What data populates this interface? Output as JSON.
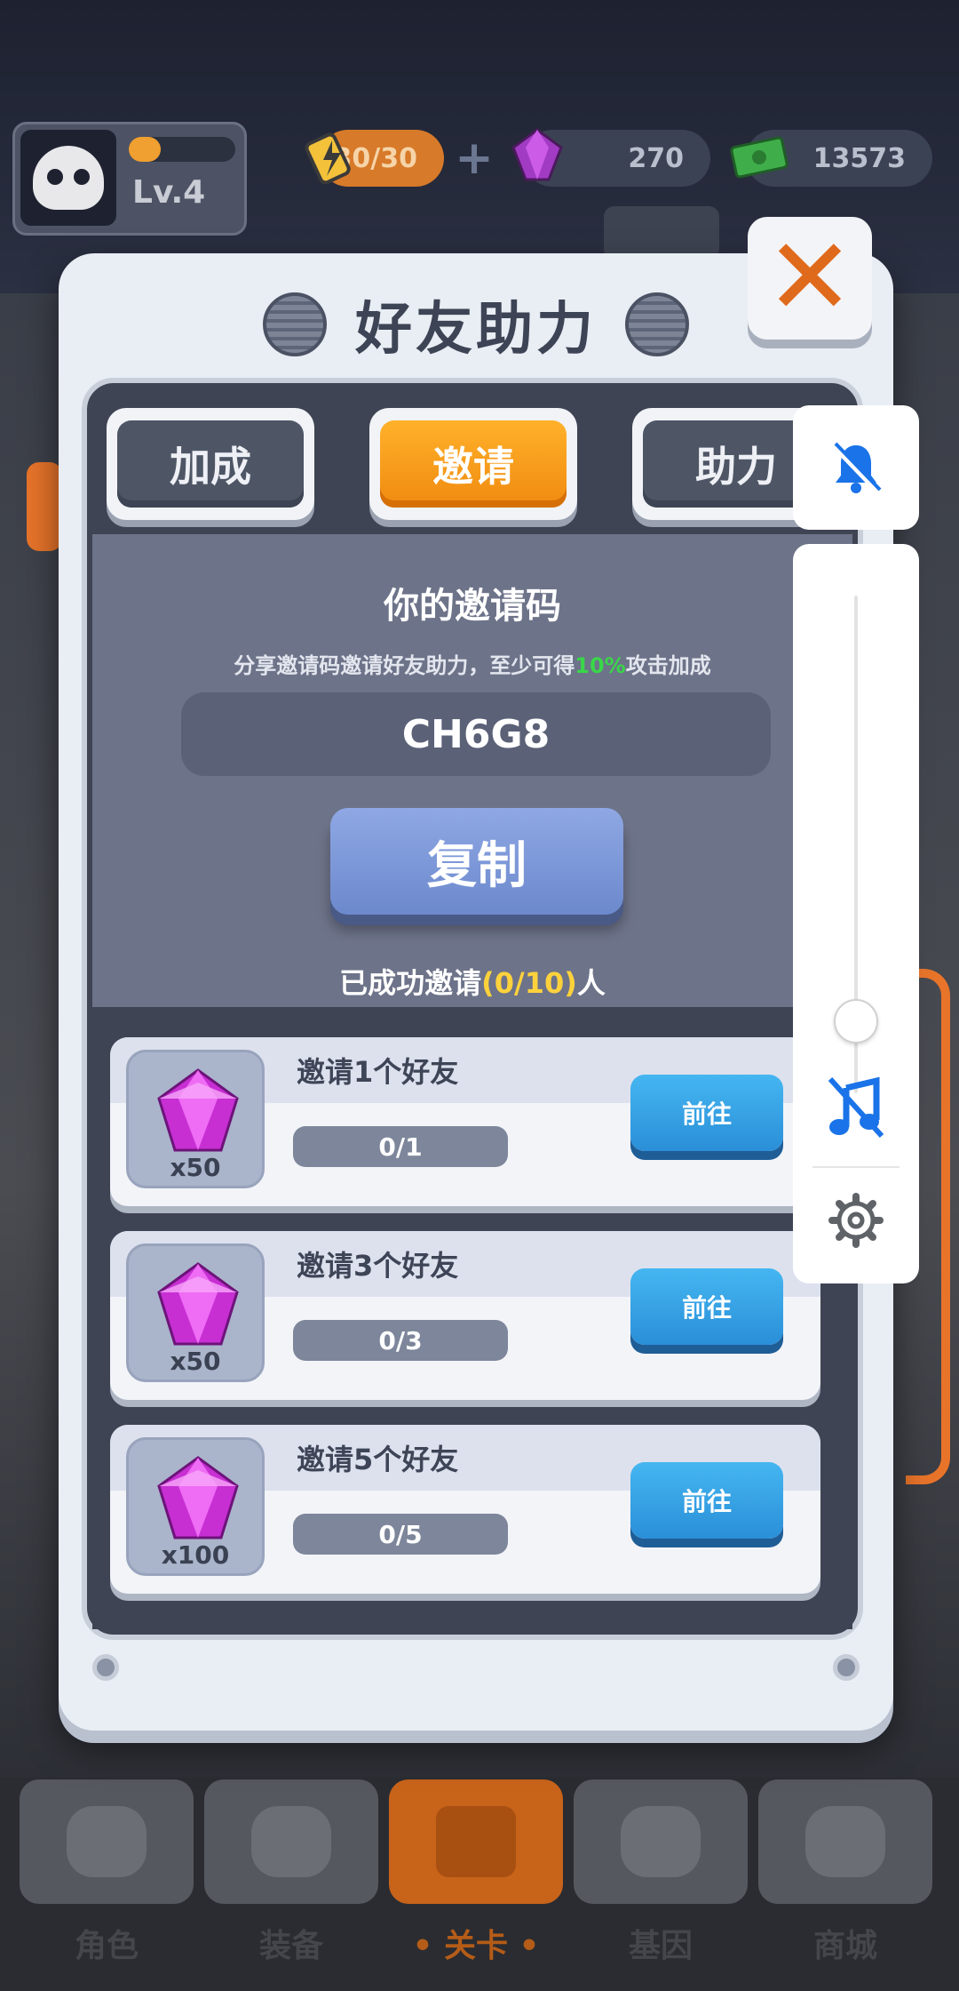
{
  "hud": {
    "level": "Lv.4",
    "xp_fraction": 0.3,
    "energy": "30/30",
    "gems": "270",
    "cash": "13573"
  },
  "dialog": {
    "title": "好友助力",
    "tabs": [
      {
        "label": "加成",
        "active": false
      },
      {
        "label": "邀请",
        "active": true
      },
      {
        "label": "助力",
        "active": false
      }
    ],
    "invite": {
      "heading": "你的邀请码",
      "desc_before": "分享邀请码邀请好友助力，至少可得",
      "desc_highlight": "10%",
      "desc_after": "攻击加成",
      "code": "CH6G8",
      "copy_label": "复制",
      "invited_before": "已成功邀请",
      "invited_count": "(0/10)",
      "invited_after": "人"
    },
    "tasks": [
      {
        "title": "邀请1个好友",
        "progress": "0/1",
        "reward": "x50",
        "button": "前往"
      },
      {
        "title": "邀请3个好友",
        "progress": "0/3",
        "reward": "x50",
        "button": "前往"
      },
      {
        "title": "邀请5个好友",
        "progress": "0/5",
        "reward": "x100",
        "button": "前往"
      }
    ]
  },
  "nav": {
    "tabs": [
      {
        "label": "角色",
        "icon": "skull-icon"
      },
      {
        "label": "装备",
        "icon": "gun-icon"
      },
      {
        "label": "• 关卡 •",
        "icon": "map-pin-icon"
      },
      {
        "label": "基因",
        "icon": "hexagon-icon"
      },
      {
        "label": "商城",
        "icon": "shop-icon"
      }
    ]
  },
  "system_overlay": {
    "volume_level": 0.1,
    "icons": [
      "bell-off-icon",
      "music-off-icon",
      "gear-icon"
    ]
  },
  "colors": {
    "accent_orange": "#f08a10",
    "button_blue": "#2a8fd8",
    "highlight_green": "#39d64a",
    "highlight_yellow": "#ffd23c"
  }
}
